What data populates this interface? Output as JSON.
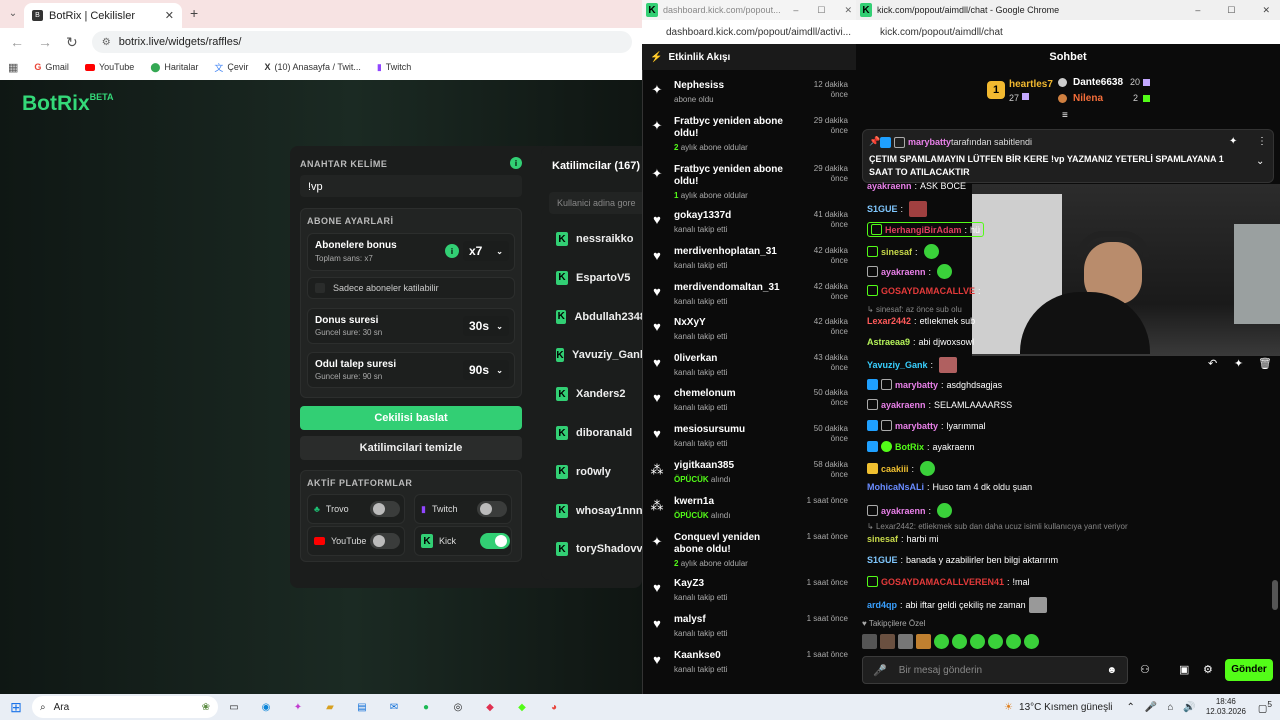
{
  "left_browser": {
    "tab_title": "BotRix | Cekilisler",
    "url": "botrix.live/widgets/raffles/",
    "bookmarks": [
      "Gmail",
      "YouTube",
      "Haritalar",
      "Çevir",
      "(10) Anasayfa / Twit...",
      "Twitch"
    ]
  },
  "botrix": {
    "logo": "BotRix",
    "logo_badge": "BETA",
    "keyword_label": "ANAHTAR KELİME",
    "keyword_value": "!vp",
    "sub_settings_label": "ABONE AYARLARİ",
    "sub_bonus_label": "Abonelere bonus",
    "sub_bonus_sub": "Toplam sans: x7",
    "sub_bonus_value": "x7",
    "subs_only_label": "Sadece aboneler katilabilir",
    "duration_label": "Donus suresi",
    "duration_sub": "Guncel sure: 30 sn",
    "duration_value": "30s",
    "claim_label": "Odul talep suresi",
    "claim_sub": "Guncel sure: 90 sn",
    "claim_value": "90s",
    "start_button": "Cekilisi baslat",
    "clear_button": "Katilimcilari temizle",
    "platforms_label": "AKTİF PLATFORMLAR",
    "platforms": [
      {
        "name": "Trovo",
        "on": false
      },
      {
        "name": "Twitch",
        "on": false
      },
      {
        "name": "YouTube",
        "on": false
      },
      {
        "name": "Kick",
        "on": true
      }
    ],
    "participants_title": "Katilimcilar (167)",
    "participants_search_placeholder": "Kullanici adina gore",
    "participants": [
      "nessraikko",
      "EspartoV5",
      "Abdullah2348",
      "Yavuziy_Gank",
      "Xanders2",
      "diboranald",
      "ro0wly",
      "whosay1nnn",
      "toryShadovv"
    ]
  },
  "activity": {
    "window_url_title": "dashboard.kick.com/popout...",
    "url": "dashboard.kick.com/popout/aimdll/activi...",
    "header": "Etkinlik Akışı",
    "events": [
      {
        "icon": "star",
        "name": "Nephesiss",
        "sub": "abone oldu",
        "sub_bold": "",
        "time": "12 dakika önce"
      },
      {
        "icon": "star",
        "name": "Fratbyc yeniden abone oldu!",
        "sub": "aylık abone oldular",
        "sub_bold": "2",
        "time": "29 dakika önce"
      },
      {
        "icon": "star",
        "name": "Fratbyc yeniden abone oldu!",
        "sub": "aylık abone oldular",
        "sub_bold": "1",
        "time": "29 dakika önce"
      },
      {
        "icon": "heart",
        "name": "gokay1337d",
        "sub": "kanalı takip etti",
        "sub_bold": "",
        "time": "41 dakika önce"
      },
      {
        "icon": "heart",
        "name": "merdivenhoplatan_31",
        "sub": "kanalı takip etti",
        "sub_bold": "",
        "time": "42 dakika önce"
      },
      {
        "icon": "heart",
        "name": "merdivendomaltan_31",
        "sub": "kanalı takip etti",
        "sub_bold": "",
        "time": "42 dakika önce"
      },
      {
        "icon": "heart",
        "name": "NxXyY",
        "sub": "kanalı takip etti",
        "sub_bold": "",
        "time": "42 dakika önce"
      },
      {
        "icon": "heart",
        "name": "0liverkan",
        "sub": "kanalı takip etti",
        "sub_bold": "",
        "time": "43 dakika önce"
      },
      {
        "icon": "heart",
        "name": "chemelonum",
        "sub": "kanalı takip etti",
        "sub_bold": "",
        "time": "50 dakika önce"
      },
      {
        "icon": "heart",
        "name": "mesiosursumu",
        "sub": "kanalı takip etti",
        "sub_bold": "",
        "time": "50 dakika önce"
      },
      {
        "icon": "dots",
        "name": "yigitkaan385",
        "sub": "alındı",
        "sub_bold": "ÖPÜCÜK",
        "time": "58 dakika önce"
      },
      {
        "icon": "dots",
        "name": "kwern1a",
        "sub": "alındı",
        "sub_bold": "ÖPÜCÜK",
        "time": "1 saat önce"
      },
      {
        "icon": "star",
        "name": "Conquevl yeniden abone oldu!",
        "sub": "aylık abone oldular",
        "sub_bold": "2",
        "time": "1 saat önce"
      },
      {
        "icon": "heart",
        "name": "KayZ3",
        "sub": "kanalı takip etti",
        "sub_bold": "",
        "time": "1 saat önce"
      },
      {
        "icon": "heart",
        "name": "malysf",
        "sub": "kanalı takip etti",
        "sub_bold": "",
        "time": "1 saat önce"
      },
      {
        "icon": "heart",
        "name": "Kaankse0",
        "sub": "kanalı takip etti",
        "sub_bold": "",
        "time": "1 saat önce"
      }
    ]
  },
  "chat": {
    "window_title": "kick.com/popout/aimdll/chat - Google Chrome",
    "url": "kick.com/popout/aimdll/chat",
    "header": "Sohbet",
    "top": [
      {
        "name": "heartles7",
        "value": "27"
      },
      {
        "name": "Dante6638",
        "value": "20"
      },
      {
        "name": "Nilena",
        "value": "2"
      }
    ],
    "pinned_by": "marybatty",
    "pinned_by_suffix": "tarafından sabitlendi",
    "pinned_text": "ÇETIM SPAMLAMAYIN LÜTFEN BİR KERE !vp YAZMANIZ YETERLİ SPAMLAYANA 1 SAAT TO ATILACAKTIR",
    "messages": [
      {
        "user": "ayakraenn",
        "color": "#e880e8",
        "text": "ASK BOCE"
      },
      {
        "user": "S1GUE",
        "color": "#80c8ff",
        "text": ""
      },
      {
        "user": "HerhangiBirAdam",
        "color": "#e04060",
        "text": "hü"
      },
      {
        "user": "sinesaf",
        "color": "#c7d94a",
        "text": ""
      },
      {
        "user": "ayakraenn",
        "color": "#e880e8",
        "text": ""
      },
      {
        "user": "GOSAYDAMACALLVE",
        "color": "#e33a3a",
        "text": ""
      },
      {
        "user": "Lexar2442",
        "color": "#ff5a5a",
        "text": "etlıekmek sub"
      },
      {
        "user": "Astraeaa9",
        "color": "#b5f35a",
        "text": "abi djwoxsowl"
      },
      {
        "user": "Yavuziy_Gank",
        "color": "#39d0ff",
        "text": ""
      },
      {
        "user": "marybatty",
        "color": "#e880e8",
        "text": "asdghdsagjas"
      },
      {
        "user": "ayakraenn",
        "color": "#e880e8",
        "text": "SELAMLAAAARSS"
      },
      {
        "user": "marybatty",
        "color": "#e880e8",
        "text": "lyarımmal"
      },
      {
        "user": "BotRix",
        "color": "#53fc18",
        "text": "ayakraenn"
      },
      {
        "user": "caakiii",
        "color": "#f0c030",
        "text": ""
      },
      {
        "user": "MohicaNsALi",
        "color": "#6a8cff",
        "text": "Huso tam 4 dk oldu şuan"
      },
      {
        "user": "ayakraenn",
        "color": "#e880e8",
        "text": ""
      },
      {
        "user": "sinesaf",
        "color": "#c7d94a",
        "text": "harbi mi"
      },
      {
        "user": "S1GUE",
        "color": "#80c8ff",
        "text": "banada y azabilirler ben bilgi aktarırım"
      },
      {
        "user": "GOSAYDAMACALLVEREN41",
        "color": "#e33a3a",
        "text": "!mal"
      },
      {
        "user": "ard4qp",
        "color": "#39a0ff",
        "text": "abi iftar geldi çekiliş ne zaman"
      }
    ],
    "reply1": "sinesaf: az önce sub olu",
    "reply2": "Lexar2442: etliekmek sub dan daha ucuz isimli kullanıcıya yanıt veriyor",
    "followers_only": "Takipçilere Özel",
    "input_placeholder": "Bir mesaj gönderin",
    "send_button": "Gönder"
  },
  "taskbar": {
    "search": "Ara",
    "weather": "13°C  Kısmen güneşli",
    "time": "18:46",
    "date": "12.03.2026",
    "notifications": "5"
  }
}
